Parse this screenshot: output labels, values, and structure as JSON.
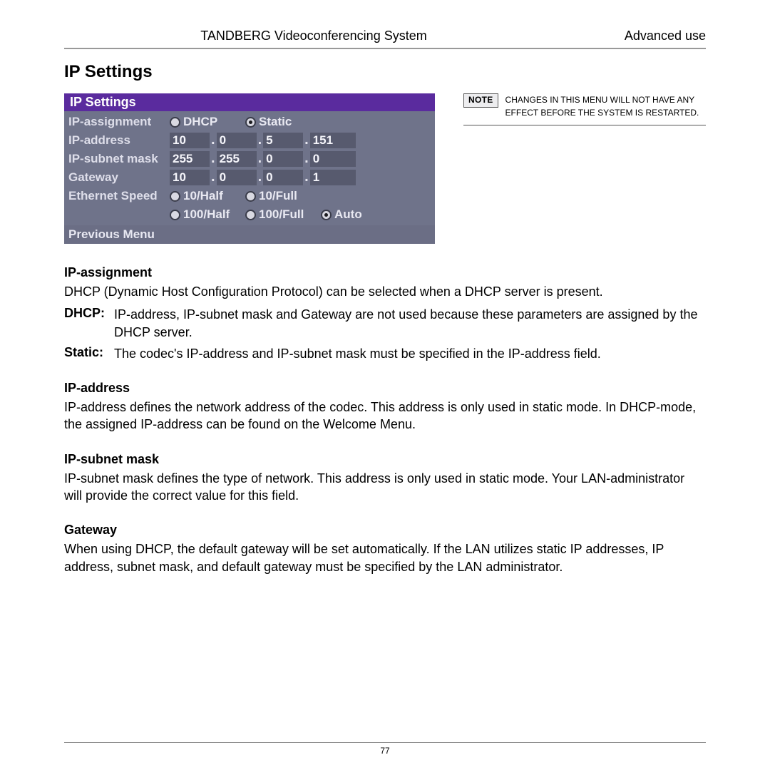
{
  "header": {
    "center": "TANDBERG Videoconferencing System",
    "right": "Advanced use"
  },
  "page_title": "IP Settings",
  "screenshot": {
    "title": "IP  Settings",
    "rows": {
      "ip_assignment": {
        "label": "IP-assignment",
        "opts": [
          "DHCP",
          "Static"
        ],
        "selected_index": 1
      },
      "ip_address": {
        "label": "IP-address",
        "octets": [
          "10",
          "0",
          "5",
          "151"
        ]
      },
      "subnet_mask": {
        "label": "IP-subnet mask",
        "octets": [
          "255",
          "255",
          "0",
          "0"
        ]
      },
      "gateway": {
        "label": "Gateway",
        "octets": [
          "10",
          "0",
          "0",
          "1"
        ]
      },
      "eth_speed": {
        "label": "Ethernet Speed",
        "opts_row1": [
          "10/Half",
          "10/Full"
        ],
        "opts_row2": [
          "100/Half",
          "100/Full",
          "Auto"
        ],
        "selected": "Auto"
      }
    },
    "prev": "Previous  Menu"
  },
  "note": {
    "badge": "NOTE",
    "lead": "C",
    "rest": "HANGES IN THIS MENU WILL NOT HAVE ANY EFFECT BEFORE THE SYSTEM IS RESTARTED."
  },
  "body": {
    "s1_h": "IP-assignment",
    "s1_p": "DHCP (Dynamic Host Configuration Protocol) can be selected when a DHCP server is present.",
    "s1_dhcp_k": "DHCP:",
    "s1_dhcp_v": "IP-address, IP-subnet mask and Gateway are not used because these parameters are assigned by the DHCP server.",
    "s1_static_k": "Static:",
    "s1_static_v": "The codec's IP-address and IP-subnet mask must be specified in the IP-address field.",
    "s2_h": "IP-address",
    "s2_p": "IP-address defines the network address of the codec. This address is only used in static mode. In DHCP-mode, the assigned IP-address can be found on the Welcome Menu.",
    "s3_h": "IP-subnet mask",
    "s3_p": "IP-subnet mask defines the type of network. This address is only used in static mode. Your LAN-administrator will provide the correct value for this field.",
    "s4_h": "Gateway",
    "s4_p": "When using DHCP, the default gateway will be set automatically. If the LAN utilizes static IP addresses, IP address, subnet mask, and default gateway must be specified by the LAN administrator."
  },
  "page_number": "77"
}
